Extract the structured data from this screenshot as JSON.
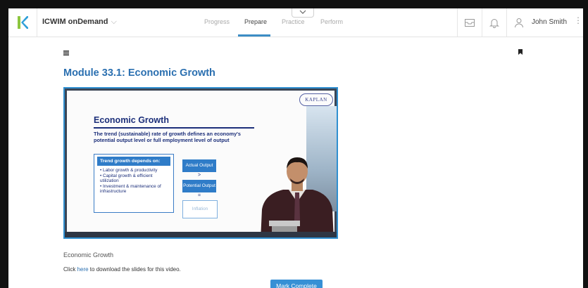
{
  "header": {
    "app_title": "ICWIM onDemand",
    "nav": [
      {
        "label": "Progress",
        "active": false
      },
      {
        "label": "Prepare",
        "active": true
      },
      {
        "label": "Practice",
        "active": false
      },
      {
        "label": "Perform",
        "active": false
      }
    ],
    "user_name": "John Smith",
    "accent_color": "#3c8dc5"
  },
  "main": {
    "title": "Module 33.1: Economic Growth",
    "video_caption": "Economic Growth",
    "download_prefix": "Click ",
    "download_link": "here",
    "download_suffix": " to download the slides for this video.",
    "mark_complete_label": "Mark Complete"
  },
  "slide": {
    "brand": "KAPLAN",
    "title": "Economic Growth",
    "line1_a": "The ",
    "line1_b": "trend (sustainable) rate of growth",
    "line1_c": " defines an economy's ",
    "line1_d": "potential output level or full employment level of output",
    "trend_head": "Trend growth depends on:",
    "trend_items": [
      "Labor growth & productivity",
      "Capital growth & efficient utilization",
      "Investment & maintenance of infrastructure"
    ],
    "box_actual": "Actual Output",
    "sym_gt": ">",
    "box_potential": "Potential Output",
    "sym_eq": "=",
    "box_inflation": "Inflation"
  }
}
